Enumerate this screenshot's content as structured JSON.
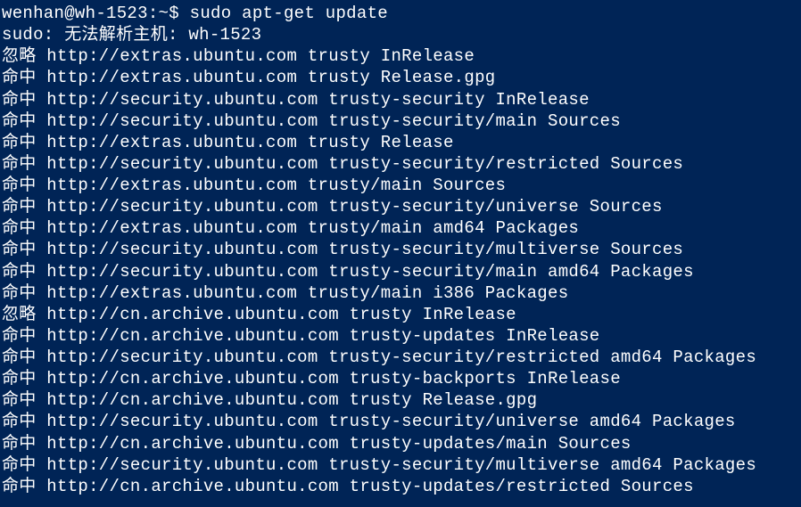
{
  "prompt": {
    "user_host": "wenhan@wh-1523",
    "path": ":~$",
    "command": "sudo apt-get update"
  },
  "lines": [
    "sudo: 无法解析主机: wh-1523",
    "忽略 http://extras.ubuntu.com trusty InRelease",
    "命中 http://extras.ubuntu.com trusty Release.gpg",
    "命中 http://security.ubuntu.com trusty-security InRelease",
    "命中 http://security.ubuntu.com trusty-security/main Sources",
    "命中 http://extras.ubuntu.com trusty Release",
    "命中 http://security.ubuntu.com trusty-security/restricted Sources",
    "命中 http://extras.ubuntu.com trusty/main Sources",
    "命中 http://security.ubuntu.com trusty-security/universe Sources",
    "命中 http://extras.ubuntu.com trusty/main amd64 Packages",
    "命中 http://security.ubuntu.com trusty-security/multiverse Sources",
    "命中 http://security.ubuntu.com trusty-security/main amd64 Packages",
    "命中 http://extras.ubuntu.com trusty/main i386 Packages",
    "忽略 http://cn.archive.ubuntu.com trusty InRelease",
    "命中 http://cn.archive.ubuntu.com trusty-updates InRelease",
    "命中 http://security.ubuntu.com trusty-security/restricted amd64 Packages",
    "命中 http://cn.archive.ubuntu.com trusty-backports InRelease",
    "命中 http://cn.archive.ubuntu.com trusty Release.gpg",
    "命中 http://security.ubuntu.com trusty-security/universe amd64 Packages",
    "命中 http://cn.archive.ubuntu.com trusty-updates/main Sources",
    "命中 http://security.ubuntu.com trusty-security/multiverse amd64 Packages",
    "命中 http://cn.archive.ubuntu.com trusty-updates/restricted Sources"
  ]
}
